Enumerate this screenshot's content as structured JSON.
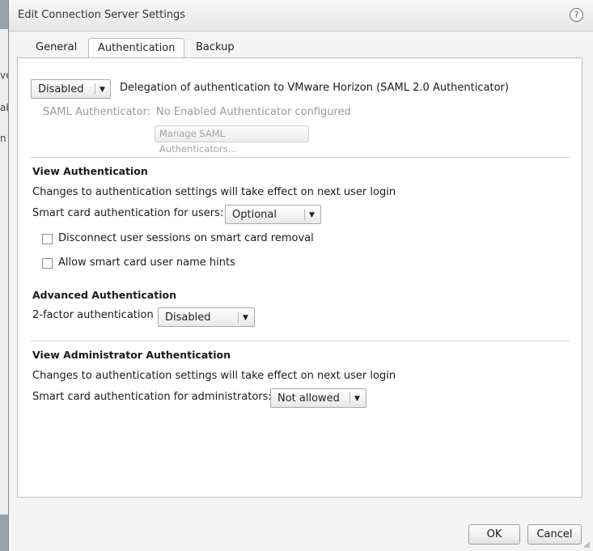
{
  "background": {
    "fragments": [
      "ve",
      "ab",
      "n"
    ]
  },
  "dialog": {
    "title": "Edit Connection Server Settings",
    "help_glyph": "?"
  },
  "tabs": [
    {
      "label": "General",
      "active": false
    },
    {
      "label": "Authentication",
      "active": true
    },
    {
      "label": "Backup",
      "active": false
    }
  ],
  "saml": {
    "delegation_value": "Disabled",
    "delegation_label": "Delegation of authentication to VMware Horizon (SAML 2.0 Authenticator)",
    "authenticator_label": "SAML Authenticator:",
    "authenticator_value": "No Enabled Authenticator configured",
    "manage_button": "Manage SAML Authenticators..."
  },
  "view_auth": {
    "heading": "View Authentication",
    "note": "Changes to authentication settings will take effect on next user login",
    "smart_card_label": "Smart card authentication for users:",
    "smart_card_value": "Optional",
    "disconnect_label": "Disconnect user sessions on smart card removal",
    "disconnect_checked": false,
    "hints_label": "Allow smart card user name hints",
    "hints_checked": false
  },
  "advanced_auth": {
    "heading": "Advanced Authentication",
    "two_factor_label": "2-factor authentication",
    "two_factor_value": "Disabled"
  },
  "admin_auth": {
    "heading": "View Administrator Authentication",
    "note": "Changes to authentication settings will take effect on next user login",
    "smart_card_label": "Smart card authentication for administrators:",
    "smart_card_value": "Not allowed"
  },
  "footer": {
    "ok_label": "OK",
    "cancel_label": "Cancel"
  }
}
